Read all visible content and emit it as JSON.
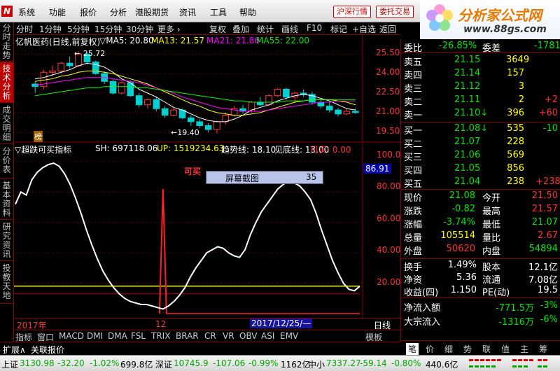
{
  "menu": {
    "logo": "N",
    "items": [
      "系统",
      "功能",
      "报价",
      "分析",
      "港股期货",
      "资讯",
      "工具",
      "帮助"
    ],
    "btn1": "沪深行情",
    "btn2": "委托交易"
  },
  "brand": {
    "title": "分析家公式网",
    "url": "www.88gs.com"
  },
  "toolbar": {
    "left": [
      "分时",
      "1分钟",
      "5分钟",
      "15分钟",
      "30分钟",
      "更多 ›"
    ],
    "right": [
      "复权",
      "叠加",
      "统计",
      "画线",
      "F10",
      "标记",
      "+自选",
      "返回"
    ]
  },
  "lefttabs": [
    "分时走势",
    "技术分析",
    "成交明细",
    "分价表",
    "基本资料",
    "研究资讯",
    "投教天地"
  ],
  "kline": {
    "title": "亿帆医药(日线,前复权)",
    "ma5": "▽MA5: 20.80",
    "ma13": "MA13: 21.57",
    "ma21": "MA21: 21.86",
    "ma55": "MA55: 22.00",
    "high_mark": "← 25.72",
    "low_mark": "←19.40",
    "badge": "榜",
    "yticks": [
      "25.50",
      "24.00",
      "22.50",
      "21.00",
      "19.50"
    ]
  },
  "indicator": {
    "name": "▽超跌可买指标",
    "sh": "SH: 697118.06",
    "up": "UP: 1519234.63",
    "trend": "趋势线: 18.10",
    "bottom": "见底线: 13.00",
    "buy": "可买: 0.00",
    "buy_mark": "可买",
    "yticks": [
      "100.00",
      "80.00",
      "60.00",
      "40.00",
      "20.00"
    ],
    "cursor_value": "86.91"
  },
  "popup": {
    "label": "屏幕截图",
    "value": "35"
  },
  "xaxis": {
    "year": "2017年",
    "month": "12",
    "cursor_date": "2017/12/25/—",
    "period": "日线"
  },
  "bottomtabs": [
    "指标",
    "窗口",
    "MACD",
    "DMI",
    "DMA",
    "FSL",
    "TRIX",
    "BRAR",
    "CR",
    "VR",
    "OBV",
    "ASI",
    "EMV"
  ],
  "bottomtabs_right": "模板",
  "ext": {
    "label1": "扩展∧",
    "label2": "关联报价"
  },
  "quote": {
    "weibi_label": "委比",
    "weibi": "-26.85%",
    "weicha_label": "委差",
    "weicha": "-1781",
    "sell": [
      {
        "label": "卖五",
        "price": "21.15",
        "vol": "3649",
        "chg": ""
      },
      {
        "label": "卖四",
        "price": "21.14",
        "vol": "157",
        "chg": ""
      },
      {
        "label": "卖三",
        "price": "21.12",
        "vol": "3",
        "chg": ""
      },
      {
        "label": "卖二",
        "price": "21.11",
        "vol": "2",
        "chg": "+2"
      },
      {
        "label": "卖一",
        "price": "21.10↓",
        "vol": "396",
        "chg": "+60"
      }
    ],
    "buy": [
      {
        "label": "买一",
        "price": "21.08↓",
        "vol": "535",
        "chg": "-10"
      },
      {
        "label": "买二",
        "price": "21.07",
        "vol": "228",
        "chg": ""
      },
      {
        "label": "买三",
        "price": "21.06",
        "vol": "569",
        "chg": ""
      },
      {
        "label": "买四",
        "price": "21.05",
        "vol": "856",
        "chg": ""
      },
      {
        "label": "买五",
        "price": "21.04",
        "vol": "238",
        "chg": "+238"
      }
    ],
    "stats": [
      [
        "现价",
        "21.08",
        "今开",
        "21.50"
      ],
      [
        "涨跌",
        "-0.82",
        "最高",
        "21.57"
      ],
      [
        "涨幅",
        "-3.74%",
        "最低",
        "21.07"
      ],
      [
        "总量",
        "105514",
        "量比",
        "2.67"
      ],
      [
        "外盘",
        "50620",
        "内盘",
        "54894"
      ]
    ],
    "fin": [
      [
        "换手",
        "1.49%",
        "股本",
        "12.1亿"
      ],
      [
        "净资",
        "5.36",
        "流通",
        "7.08亿"
      ],
      [
        "收益(四)",
        "1.150",
        "PE(动)",
        "19.5"
      ]
    ],
    "flow": [
      [
        "净流入额",
        "-771.5万",
        "-3%"
      ],
      [
        "大宗流入",
        "-1316万",
        "-6%"
      ]
    ]
  },
  "rtabs": [
    "笔",
    "价",
    "细",
    "势",
    "联",
    "值",
    "主",
    "筹"
  ],
  "status": {
    "sh_label": "上证",
    "sh": "3130.98",
    "sh_chg": "-32.20",
    "sh_pct": "-1.02%",
    "sh_amt": "699.8亿",
    "sz_label": "深证",
    "sz": "10745.9",
    "sz_chg": "-107.06",
    "sz_pct": "-0.99%",
    "sz_amt": "1162亿",
    "zx_label": "中小",
    "zx": "7337.27",
    "zx_chg": "-59.14",
    "zx_pct": "-0.80%",
    "zx_amt": "440.6亿"
  },
  "chart_data": {
    "type": "candlestick",
    "price_axis": {
      "min": 19.0,
      "max": 26.0
    },
    "indicator_axis": {
      "min": 0,
      "max": 105
    },
    "candles": [
      [
        23.2,
        23.4,
        22.5,
        23.0
      ],
      [
        23.0,
        24.3,
        22.8,
        24.1
      ],
      [
        24.1,
        24.6,
        23.8,
        24.2
      ],
      [
        24.2,
        24.9,
        24.0,
        24.8
      ],
      [
        24.8,
        25.3,
        24.4,
        24.6
      ],
      [
        24.6,
        25.72,
        24.5,
        25.5
      ],
      [
        25.5,
        25.6,
        24.7,
        24.9
      ],
      [
        24.9,
        25.0,
        23.9,
        24.0
      ],
      [
        24.0,
        24.2,
        23.2,
        23.4
      ],
      [
        23.4,
        23.6,
        22.4,
        22.5
      ],
      [
        22.5,
        23.4,
        22.4,
        23.3
      ],
      [
        23.3,
        23.5,
        22.2,
        22.3
      ],
      [
        22.3,
        22.5,
        21.4,
        21.6
      ],
      [
        21.6,
        22.1,
        21.3,
        22.0
      ],
      [
        22.0,
        22.2,
        21.1,
        21.3
      ],
      [
        21.3,
        21.5,
        20.6,
        20.8
      ],
      [
        20.8,
        21.4,
        20.7,
        21.2
      ],
      [
        21.2,
        21.3,
        20.5,
        20.6
      ],
      [
        20.6,
        20.8,
        20.0,
        20.3
      ],
      [
        20.3,
        20.5,
        19.8,
        20.0
      ],
      [
        20.0,
        20.2,
        19.5,
        19.7
      ],
      [
        19.7,
        20.4,
        19.4,
        20.3
      ],
      [
        20.3,
        21.0,
        20.1,
        20.8
      ],
      [
        20.8,
        21.5,
        20.7,
        21.3
      ],
      [
        21.3,
        21.6,
        20.9,
        21.1
      ],
      [
        21.1,
        21.9,
        21.0,
        21.8
      ],
      [
        21.8,
        22.2,
        21.5,
        21.6
      ],
      [
        21.6,
        22.4,
        21.5,
        22.3
      ],
      [
        22.3,
        22.9,
        22.2,
        22.8
      ],
      [
        22.8,
        22.9,
        22.0,
        22.2
      ],
      [
        22.2,
        22.6,
        21.8,
        22.5
      ],
      [
        22.5,
        22.8,
        22.2,
        22.4
      ],
      [
        22.4,
        22.6,
        21.6,
        21.8
      ],
      [
        21.8,
        22.0,
        21.3,
        21.5
      ],
      [
        21.5,
        21.8,
        21.0,
        21.2
      ],
      [
        21.2,
        21.4,
        20.7,
        20.9
      ],
      [
        20.9,
        21.3,
        20.8,
        21.1
      ],
      [
        21.1,
        21.3,
        20.9,
        21.0
      ]
    ],
    "ma_series": [
      {
        "name": "MA5",
        "color": "#ffffff",
        "values": [
          23.6,
          23.7,
          23.9,
          24.1,
          24.3,
          24.6,
          24.8,
          24.7,
          24.5,
          24.1,
          23.6,
          23.3,
          22.8,
          22.5,
          22.2,
          21.8,
          21.4,
          21.2,
          20.9,
          20.6,
          20.4,
          20.3,
          20.3,
          20.5,
          20.8,
          21.2,
          21.4,
          21.6,
          21.9,
          22.1,
          22.3,
          22.4,
          22.3,
          22.1,
          21.9,
          21.6,
          21.3,
          21.2
        ]
      },
      {
        "name": "MA13",
        "color": "#ffff00",
        "values": [
          23.4,
          23.5,
          23.6,
          23.8,
          23.9,
          24.1,
          24.2,
          24.2,
          24.1,
          24.0,
          23.8,
          23.6,
          23.4,
          23.2,
          22.9,
          22.6,
          22.3,
          22.0,
          21.7,
          21.5,
          21.2,
          21.0,
          20.9,
          20.8,
          20.8,
          20.9,
          21.0,
          21.2,
          21.4,
          21.6,
          21.8,
          21.9,
          22.0,
          22.0,
          22.0,
          21.9,
          21.8,
          21.6
        ]
      },
      {
        "name": "MA21",
        "color": "#ff00ff",
        "values": [
          23.1,
          23.2,
          23.3,
          23.4,
          23.5,
          23.6,
          23.7,
          23.7,
          23.7,
          23.6,
          23.5,
          23.4,
          23.3,
          23.1,
          22.9,
          22.7,
          22.5,
          22.2,
          22.0,
          21.8,
          21.6,
          21.4,
          21.3,
          21.2,
          21.1,
          21.1,
          21.1,
          21.2,
          21.3,
          21.4,
          21.5,
          21.6,
          21.7,
          21.8,
          21.8,
          21.9,
          21.9,
          21.9
        ]
      },
      {
        "name": "MA55",
        "color": "#00ff00",
        "values": [
          22.3,
          22.4,
          22.5,
          22.6,
          22.7,
          22.8,
          22.9,
          22.9,
          23.0,
          23.0,
          23.0,
          23.0,
          22.9,
          22.9,
          22.8,
          22.7,
          22.6,
          22.5,
          22.4,
          22.3,
          22.2,
          22.1,
          22.0,
          21.9,
          21.9,
          21.8,
          21.8,
          21.8,
          21.8,
          21.9,
          21.9,
          21.9,
          22.0,
          22.0,
          22.0,
          22.0,
          22.0,
          22.0
        ]
      }
    ],
    "indicator_line": [
      72,
      80,
      78,
      88,
      93,
      96,
      98,
      99,
      97,
      92,
      85,
      76,
      66,
      55,
      45,
      36,
      28,
      22,
      17,
      13,
      10,
      8,
      7,
      6,
      6,
      5,
      4,
      3,
      5,
      8,
      12,
      17,
      24,
      30,
      35,
      40,
      42,
      44,
      43,
      40,
      38,
      37,
      42,
      52,
      60,
      67,
      72,
      77,
      82,
      85,
      87,
      86,
      84,
      80,
      75,
      66,
      55,
      45,
      35,
      27,
      20,
      16,
      15,
      18
    ],
    "trend_line": 18.1,
    "bottom_line": 13.0,
    "buy_signal_index": 27,
    "buy_signal_value": 82
  }
}
